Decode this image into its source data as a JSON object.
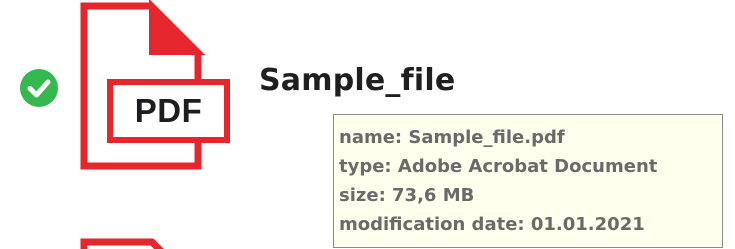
{
  "file": {
    "name": "Sample_file",
    "icon": "pdf-file-icon",
    "icon_label": "PDF",
    "status_icon": "check-circle-icon",
    "selected": true
  },
  "tooltip": {
    "name_line": "name: Sample_file.pdf",
    "type_line": "type: Adobe Acrobat Document",
    "size_line": "size: 73,6 MB",
    "date_line": "modification date: 01.01.2021"
  },
  "next_item": {
    "icon": "pdf-file-icon"
  },
  "colors": {
    "accent_red": "#e5262d",
    "check_green": "#34b84f",
    "tooltip_bg": "#ffffee",
    "tooltip_text": "#6a6a6a"
  }
}
